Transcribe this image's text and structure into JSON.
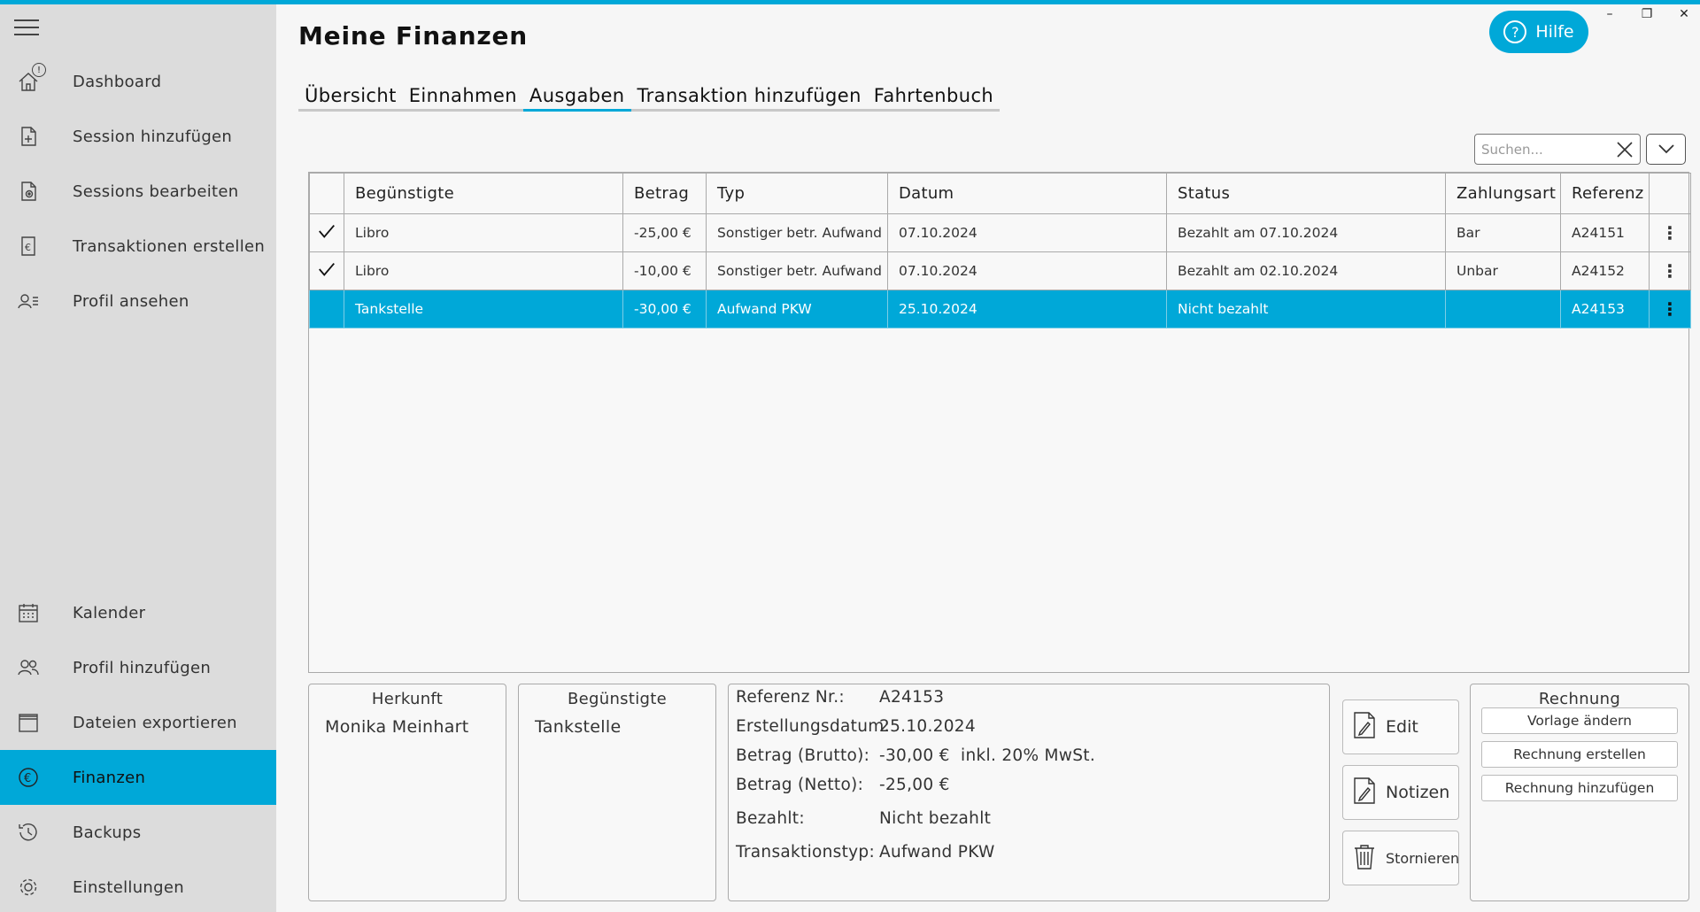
{
  "window": {
    "help_label": "Hilfe",
    "minimize": "–",
    "restore": "❐",
    "close": "✕"
  },
  "sidebar": {
    "items": [
      {
        "label": "Dashboard",
        "icon": "home-icon",
        "badge": "!"
      },
      {
        "label": "Session hinzufügen",
        "icon": "add-document-icon"
      },
      {
        "label": "Sessions bearbeiten",
        "icon": "view-document-icon"
      },
      {
        "label": "Transaktionen erstellen",
        "icon": "euro-document-icon"
      },
      {
        "label": "Profil ansehen",
        "icon": "profile-list-icon"
      },
      {
        "label": "Kalender",
        "icon": "calendar-icon"
      },
      {
        "label": "Profil hinzufügen",
        "icon": "users-icon"
      },
      {
        "label": "Dateien exportieren",
        "icon": "archive-icon"
      },
      {
        "label": "Finanzen",
        "icon": "euro-icon",
        "active": true
      },
      {
        "label": "Backups",
        "icon": "history-icon"
      },
      {
        "label": "Einstellungen",
        "icon": "gear-icon"
      }
    ]
  },
  "page": {
    "title": "Meine Finanzen",
    "tabs": [
      "Übersicht",
      "Einnahmen",
      "Ausgaben",
      "Transaktion hinzufügen",
      "Fahrtenbuch"
    ],
    "active_tab": "Ausgaben"
  },
  "search": {
    "placeholder": "Suchen...",
    "value": ""
  },
  "table": {
    "columns": [
      "",
      "Begünstigte",
      "Betrag",
      "Typ",
      "Datum",
      "Status",
      "Zahlungsart",
      "Referenz",
      ""
    ],
    "rows": [
      {
        "checked": true,
        "beguenstigte": "Libro",
        "betrag": "-25,00 €",
        "typ": "Sonstiger betr. Aufwand",
        "datum": "07.10.2024",
        "status": "Bezahlt am 07.10.2024",
        "zahlungsart": "Bar",
        "referenz": "A24151",
        "selected": false
      },
      {
        "checked": true,
        "beguenstigte": "Libro",
        "betrag": "-10,00 €",
        "typ": "Sonstiger betr. Aufwand",
        "datum": "07.10.2024",
        "status": "Bezahlt am 02.10.2024",
        "zahlungsart": "Unbar",
        "referenz": "A24152",
        "selected": false
      },
      {
        "checked": false,
        "beguenstigte": "Tankstelle",
        "betrag": "-30,00 €",
        "typ": "Aufwand PKW",
        "datum": "25.10.2024",
        "status": "Nicht bezahlt",
        "zahlungsart": "",
        "referenz": "A24153",
        "selected": true
      }
    ]
  },
  "details": {
    "herkunft_title": "Herkunft",
    "herkunft_value": "Monika Meinhart",
    "beguenstigte_title": "Begünstigte",
    "beguenstigte_value": "Tankstelle",
    "fields": [
      {
        "key": "Referenz Nr.:",
        "value": "A24153"
      },
      {
        "key": "Erstellungsdatum:",
        "value": "25.10.2024"
      },
      {
        "key": "Betrag (Brutto):",
        "value": "-30,00 €  inkl. 20% MwSt."
      },
      {
        "key": "Betrag (Netto):",
        "value": "-25,00 €"
      },
      {
        "key": "Bezahlt:",
        "value": "Nicht bezahlt"
      },
      {
        "key": "Transaktionstyp:",
        "value": "Aufwand PKW"
      }
    ]
  },
  "actions": {
    "edit": "Edit",
    "notes": "Notizen",
    "cancel": "Stornieren"
  },
  "invoice": {
    "title": "Rechnung",
    "buttons": [
      "Vorlage ändern",
      "Rechnung erstellen",
      "Rechnung hinzufügen"
    ]
  },
  "colors": {
    "accent": "#00a8d8",
    "sidebar_bg": "#dcdcdc",
    "page_bg": "#f6f6f6"
  }
}
